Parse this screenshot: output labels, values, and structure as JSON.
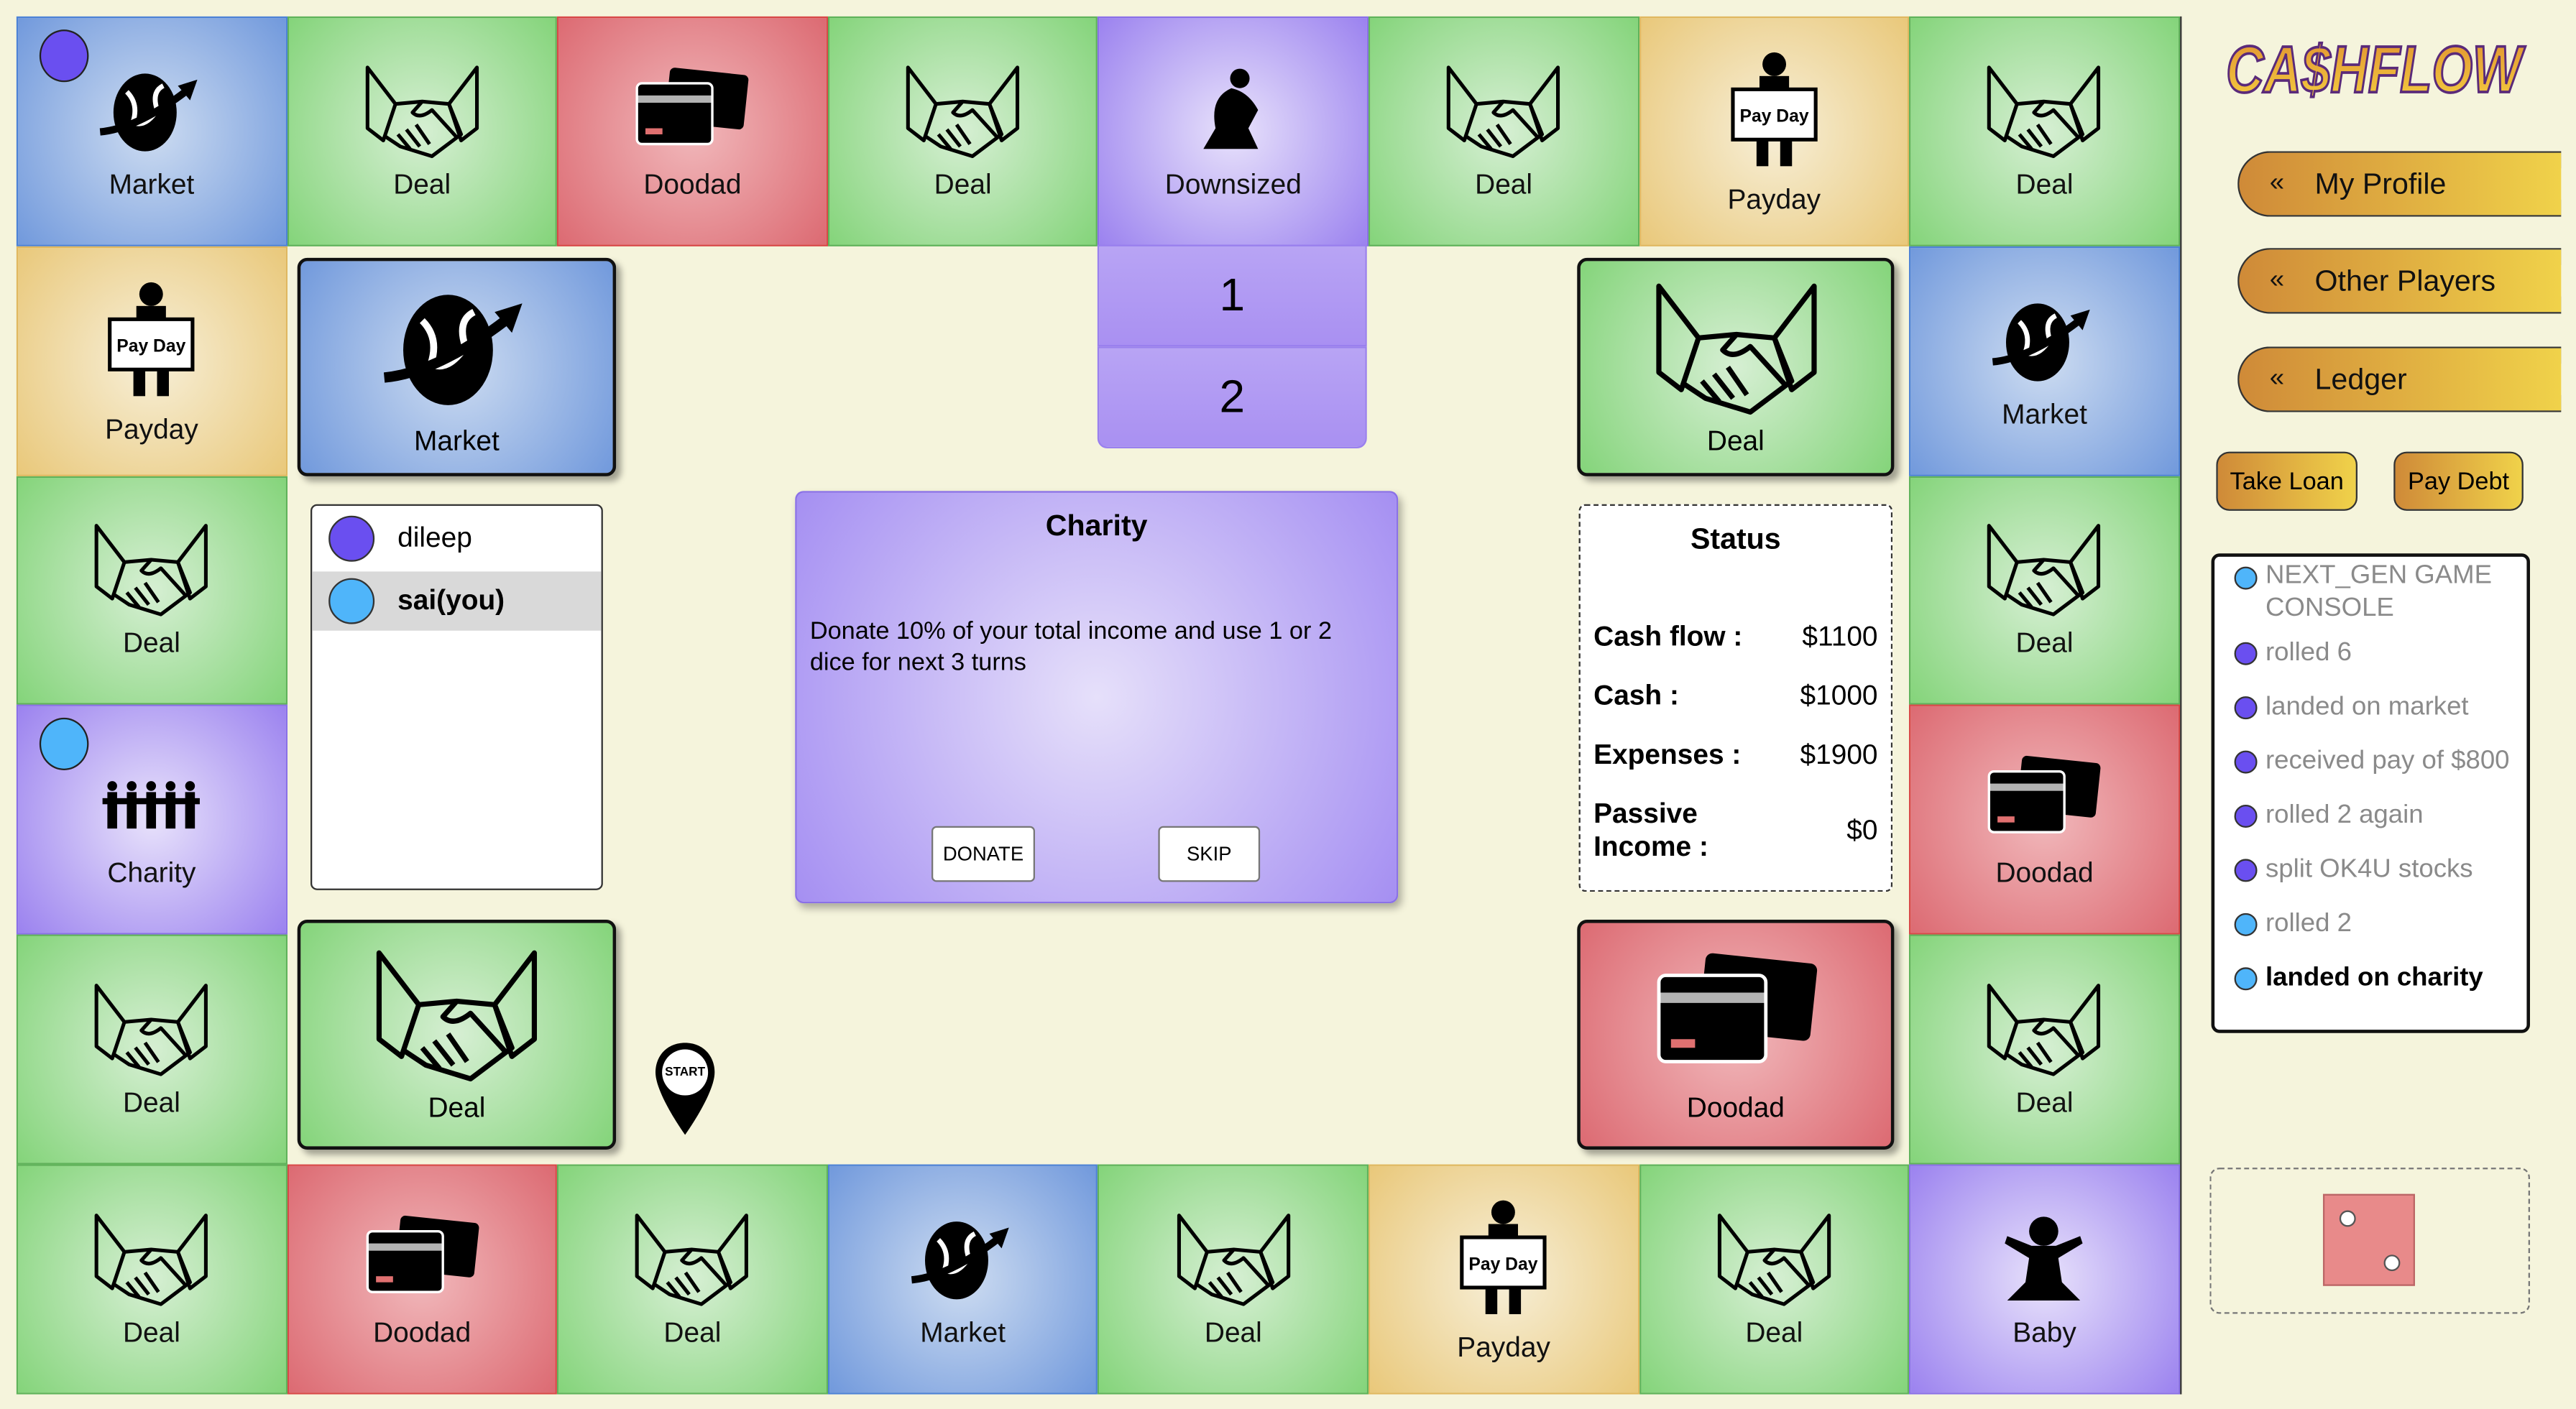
{
  "board": {
    "tiles": [
      {
        "label": "Market",
        "type": "market",
        "icon": "globe-icon"
      },
      {
        "label": "Deal",
        "type": "deal",
        "icon": "handshake-icon"
      },
      {
        "label": "Doodad",
        "type": "doodad",
        "icon": "credit-card-icon"
      },
      {
        "label": "Deal",
        "type": "deal",
        "icon": "handshake-icon"
      },
      {
        "label": "Downsized",
        "type": "purple",
        "icon": "kneeling-person-icon"
      },
      {
        "label": "Deal",
        "type": "deal",
        "icon": "handshake-icon"
      },
      {
        "label": "Payday",
        "type": "payday",
        "icon": "payday-sign-icon"
      },
      {
        "label": "Deal",
        "type": "deal",
        "icon": "handshake-icon"
      },
      {
        "label": "Market",
        "type": "market",
        "icon": "globe-icon"
      },
      {
        "label": "Deal",
        "type": "deal",
        "icon": "handshake-icon"
      },
      {
        "label": "Doodad",
        "type": "doodad",
        "icon": "credit-card-icon"
      },
      {
        "label": "Deal",
        "type": "deal",
        "icon": "handshake-icon"
      },
      {
        "label": "Baby",
        "type": "purple",
        "icon": "baby-icon"
      },
      {
        "label": "Deal",
        "type": "deal",
        "icon": "handshake-icon"
      },
      {
        "label": "Payday",
        "type": "payday",
        "icon": "payday-sign-icon"
      },
      {
        "label": "Deal",
        "type": "deal",
        "icon": "handshake-icon"
      },
      {
        "label": "Market",
        "type": "market",
        "icon": "globe-icon"
      },
      {
        "label": "Deal",
        "type": "deal",
        "icon": "handshake-icon"
      },
      {
        "label": "Doodad",
        "type": "doodad",
        "icon": "credit-card-icon"
      },
      {
        "label": "Deal",
        "type": "deal",
        "icon": "handshake-icon"
      },
      {
        "label": "Deal",
        "type": "deal",
        "icon": "handshake-icon"
      },
      {
        "label": "Charity",
        "type": "purple",
        "icon": "charity-people-icon"
      },
      {
        "label": "Deal",
        "type": "deal",
        "icon": "handshake-icon"
      },
      {
        "label": "Payday",
        "type": "payday",
        "icon": "payday-sign-icon"
      },
      {
        "label": "Deal",
        "type": "deal",
        "icon": "handshake-icon"
      }
    ],
    "payday_sign_text": "Pay Day",
    "start_label": "START",
    "dice_choices": [
      "1",
      "2"
    ],
    "decks": {
      "market": "Market",
      "deal_right": "Deal",
      "deal_left": "Deal",
      "doodad": "Doodad"
    }
  },
  "tokens": [
    {
      "player": "dileep",
      "tile": "Market",
      "color": "#6a4ff0"
    },
    {
      "player": "sai(you)",
      "tile": "Charity",
      "color": "#4fb5fa"
    }
  ],
  "players": [
    {
      "name": "dileep",
      "color": "#6a4ff0",
      "current": false
    },
    {
      "name": "sai(you)",
      "color": "#4fb5fa",
      "current": true
    }
  ],
  "charity": {
    "title": "Charity",
    "body": "Donate 10% of your total income and use 1 or 2 dice for next 3 turns",
    "donate": "DONATE",
    "skip": "SKIP"
  },
  "status": {
    "title": "Status",
    "rows": [
      {
        "label": "Cash flow :",
        "value": "$1100"
      },
      {
        "label": "Cash :",
        "value": "$1000"
      },
      {
        "label": "Expenses :",
        "value": "$1900"
      },
      {
        "label": "Passive Income :",
        "value": "$0"
      }
    ]
  },
  "sidebar": {
    "logo": "CA$HFLOW",
    "nav": [
      {
        "label": "My Profile",
        "chevron": "«"
      },
      {
        "label": "Other Players",
        "chevron": "«"
      },
      {
        "label": "Ledger",
        "chevron": "«"
      }
    ],
    "take_loan": "Take Loan",
    "pay_debt": "Pay Debt",
    "ledger": [
      {
        "text": "NEXT_GEN GAME CONSOLE",
        "color": "#4fb5fa",
        "bold": false
      },
      {
        "text": "rolled 6",
        "color": "#6a4ff0",
        "bold": false
      },
      {
        "text": "landed on market",
        "color": "#6a4ff0",
        "bold": false
      },
      {
        "text": "received pay of $800",
        "color": "#6a4ff0",
        "bold": false
      },
      {
        "text": "rolled 2 again",
        "color": "#6a4ff0",
        "bold": false
      },
      {
        "text": "split OK4U stocks",
        "color": "#6a4ff0",
        "bold": false
      },
      {
        "text": "rolled 2",
        "color": "#4fb5fa",
        "bold": false
      },
      {
        "text": "landed on charity",
        "color": "#4fb5fa",
        "bold": true
      }
    ],
    "die_value": 2,
    "die_color": "#e88a8a"
  }
}
